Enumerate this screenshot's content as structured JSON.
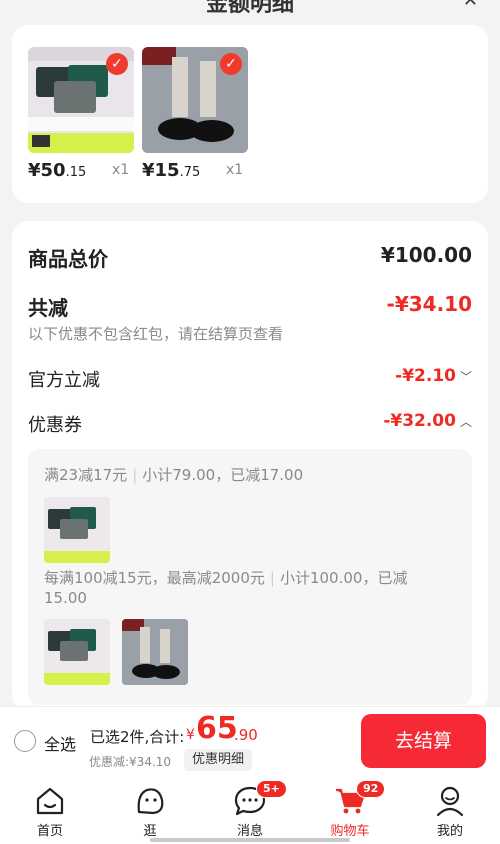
{
  "header": {
    "title": "金额明细",
    "close_icon": "close-icon"
  },
  "cart_items": [
    {
      "price_int": "¥50",
      "price_dec": ".15",
      "qty": "x1"
    },
    {
      "price_int": "¥15",
      "price_dec": ".75",
      "qty": "x1"
    }
  ],
  "breakdown": {
    "total_label": "商品总价",
    "total_value": "¥100.00",
    "reduce_label": "共减",
    "reduce_value": "-¥34.10",
    "note": "以下优惠不包含红包，请在结算页查看",
    "official_label": "官方立减",
    "official_value": "-¥2.10",
    "coupon_label": "优惠券",
    "coupon_value": "-¥32.00"
  },
  "coupons": {
    "c1_rule": "满23减17元",
    "c1_detail": "小计79.00，已减17.00",
    "c2_rule": "每满100减15元，最高减2000元",
    "c2_detail": "小计100.00，已减",
    "c2_detail2": "15.00"
  },
  "checkout": {
    "select_all": "全选",
    "summary": "已选2件,合计:",
    "total_currency": "¥",
    "total_int": "65",
    "total_dec": ".90",
    "discount": "优惠减:¥34.10",
    "detail_button": "优惠明细",
    "pay_button": "去结算"
  },
  "tabbar": [
    {
      "label": "首页",
      "icon": "home-icon"
    },
    {
      "label": "逛",
      "icon": "browse-icon"
    },
    {
      "label": "消息",
      "icon": "message-icon",
      "badge": "5+"
    },
    {
      "label": "购物车",
      "icon": "cart-icon",
      "badge": "92"
    },
    {
      "label": "我的",
      "icon": "profile-icon"
    }
  ],
  "colors": {
    "accent": "#ee2a24",
    "pay_button": "#f62a36",
    "background": "#f3f3f3"
  }
}
